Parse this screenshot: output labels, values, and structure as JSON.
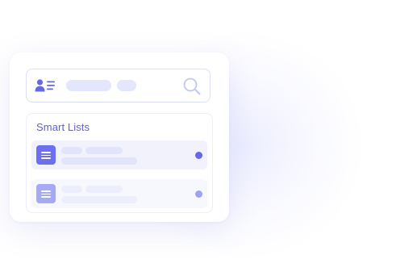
{
  "smart_lists": {
    "title": "Smart Lists",
    "items": [
      {
        "state": "active"
      },
      {
        "state": "inactive"
      }
    ]
  },
  "icons": {
    "contacts": "contacts-icon",
    "search": "search-icon",
    "list": "list-icon",
    "status": "status-dot"
  },
  "colors": {
    "accent": "#6468e6",
    "accent_light": "#a6aaf4",
    "title_text": "#5c60d6",
    "placeholder": "#e4e6fb"
  }
}
